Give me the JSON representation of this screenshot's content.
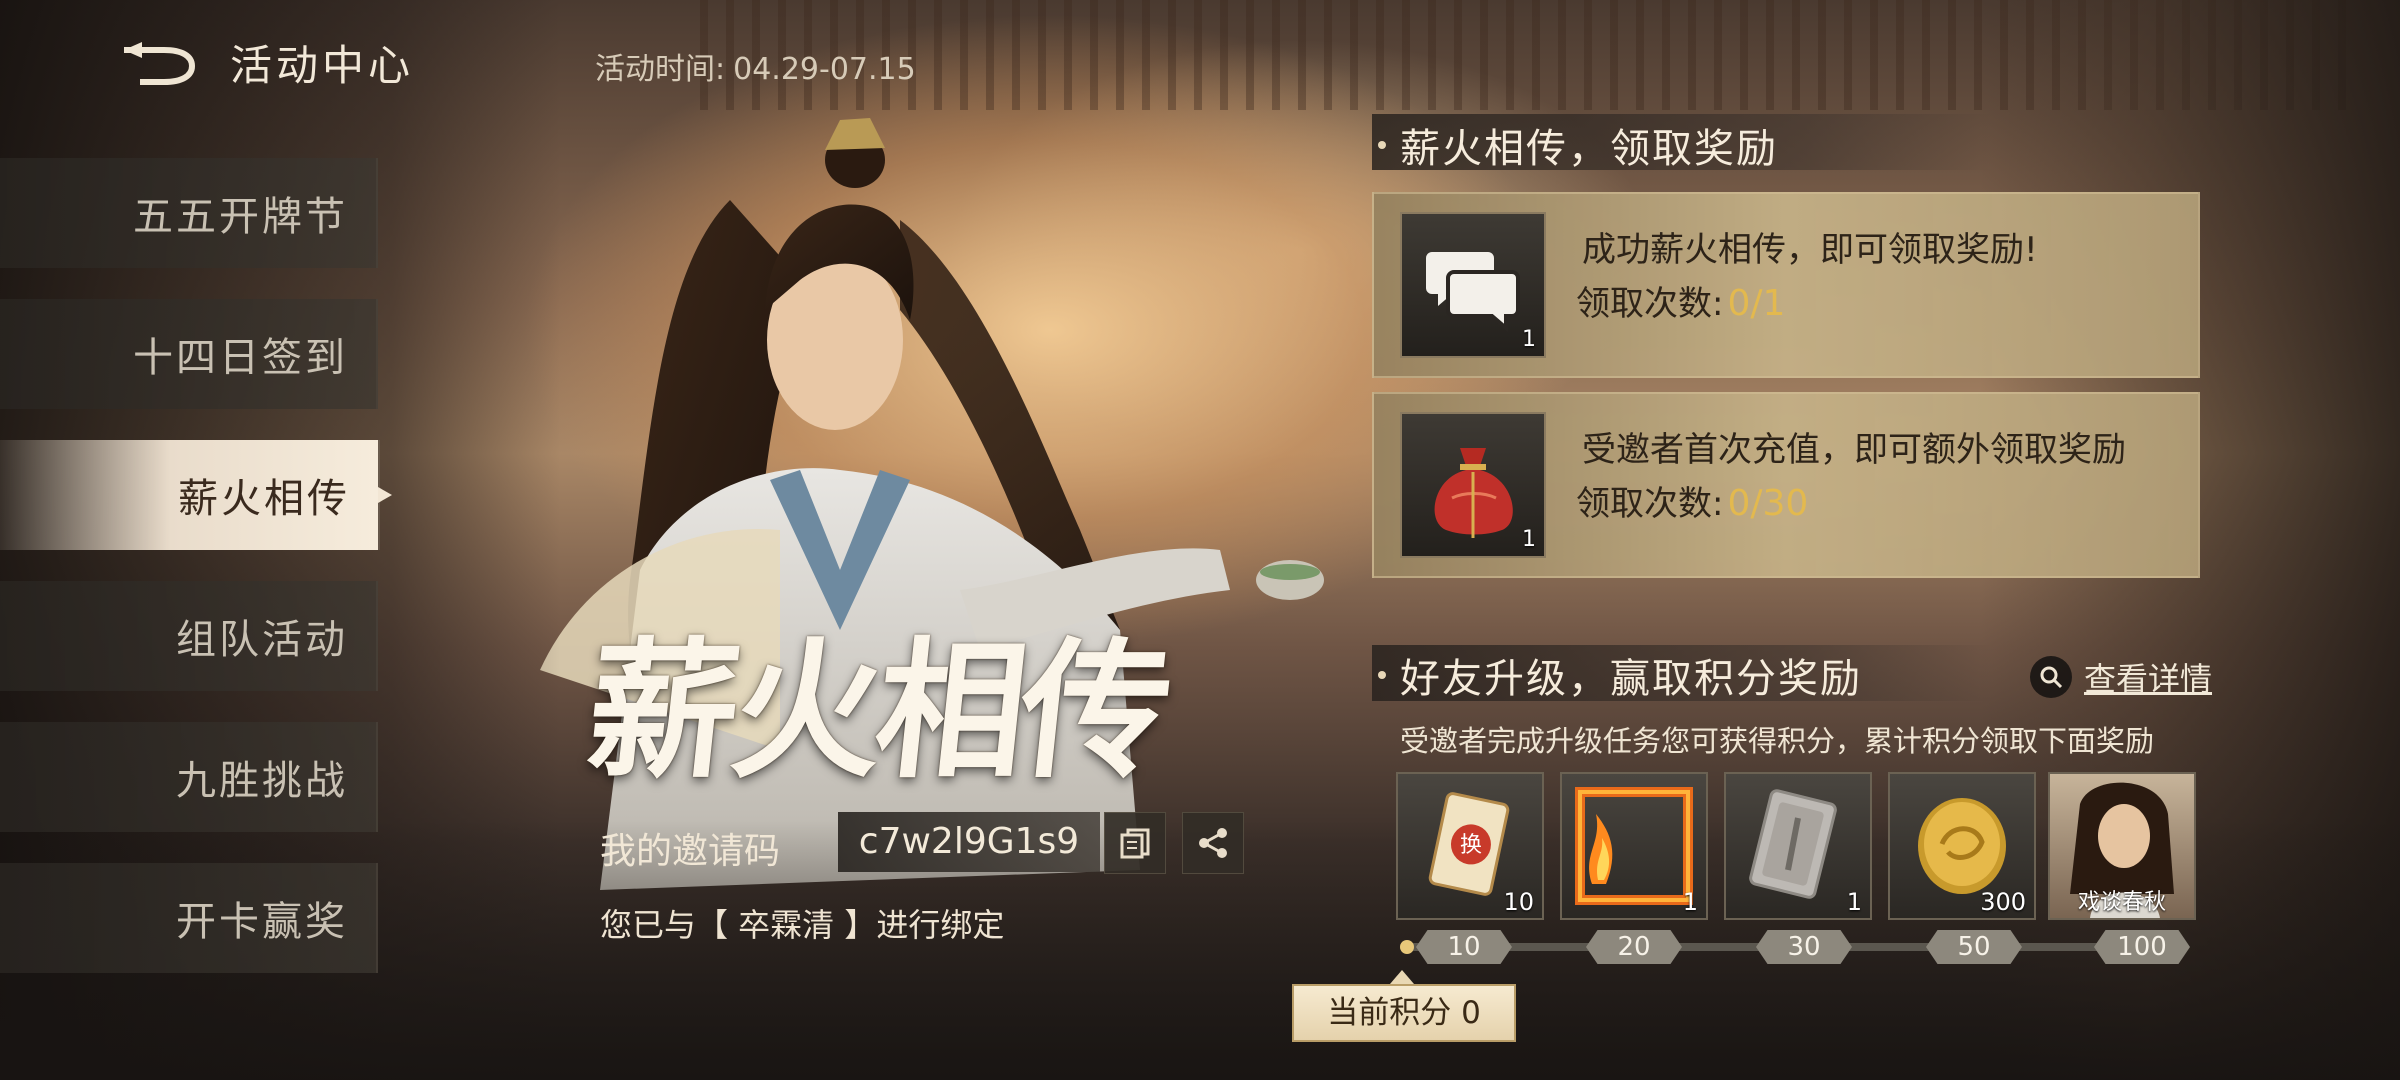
{
  "header": {
    "title": "活动中心",
    "event_time_label": "活动时间:",
    "event_time_value": "04.29-07.15"
  },
  "sidebar": {
    "items": [
      {
        "label": "五五开牌节",
        "active": false
      },
      {
        "label": "十四日签到",
        "active": false
      },
      {
        "label": "薪火相传",
        "active": true
      },
      {
        "label": "组队活动",
        "active": false
      },
      {
        "label": "九胜挑战",
        "active": false
      },
      {
        "label": "开卡赢奖",
        "active": false
      }
    ]
  },
  "hero": {
    "calligraphy_title": "薪火相传",
    "invite_label": "我的邀请码",
    "invite_code": "c7w2l9G1s9",
    "bind_text": "您已与【 卒霖清 】进行绑定"
  },
  "section1": {
    "title": "薪火相传，领取奖励",
    "cards": [
      {
        "icon": "chat-bubbles-icon",
        "qty": "1",
        "title": "成功薪火相传，即可领取奖励!",
        "count_label": "领取次数:",
        "count_value": "0/1"
      },
      {
        "icon": "red-pouch-icon",
        "qty": "1",
        "title": "受邀者首次充值，即可额外领取奖励",
        "count_label": "领取次数:",
        "count_value": "0/30"
      }
    ]
  },
  "section2": {
    "title": "好友升级，赢取积分奖励",
    "detail_link": "查看详情",
    "description": "受邀者完成升级任务您可获得积分，累计积分领取下面奖励",
    "rewards": [
      {
        "icon": "exchange-card-icon",
        "qty": "10"
      },
      {
        "icon": "fire-frame-icon",
        "qty": "1"
      },
      {
        "icon": "silver-card-icon",
        "qty": "1"
      },
      {
        "icon": "gold-coin-icon",
        "qty": "300"
      },
      {
        "icon": "portrait-icon",
        "label": "戏谈春秋"
      }
    ],
    "milestones": [
      "10",
      "20",
      "30",
      "50",
      "100"
    ],
    "current_score_label": "当前积分",
    "current_score": "0"
  },
  "colors": {
    "accent_gold": "#e3b94e",
    "sidebar_active": "#f6ecdc",
    "card_bg": "#c4b086"
  }
}
